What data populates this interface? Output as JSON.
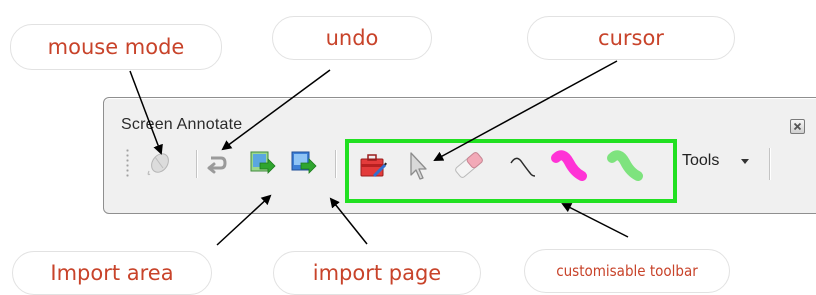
{
  "window": {
    "title": "Screen Annotate",
    "tools_label": "Tools"
  },
  "callouts": {
    "mouse_mode": "mouse mode",
    "undo": "undo",
    "cursor": "cursor",
    "import_area": "Import area",
    "import_page": "import page",
    "customisable_toolbar": "customisable toolbar"
  },
  "colors": {
    "callout_text": "#c8432a",
    "highlight_border": "#21e021",
    "pen_magenta": "#ff33d6",
    "pen_green": "#7ee37e"
  },
  "icons": [
    "mouse-mode-icon",
    "undo-icon",
    "import-area-icon",
    "import-page-icon",
    "toolbox-icon",
    "cursor-icon",
    "eraser-icon",
    "pen-icon",
    "magenta-highlighter-icon",
    "green-highlighter-icon",
    "dropdown-arrow-icon",
    "close-icon"
  ]
}
